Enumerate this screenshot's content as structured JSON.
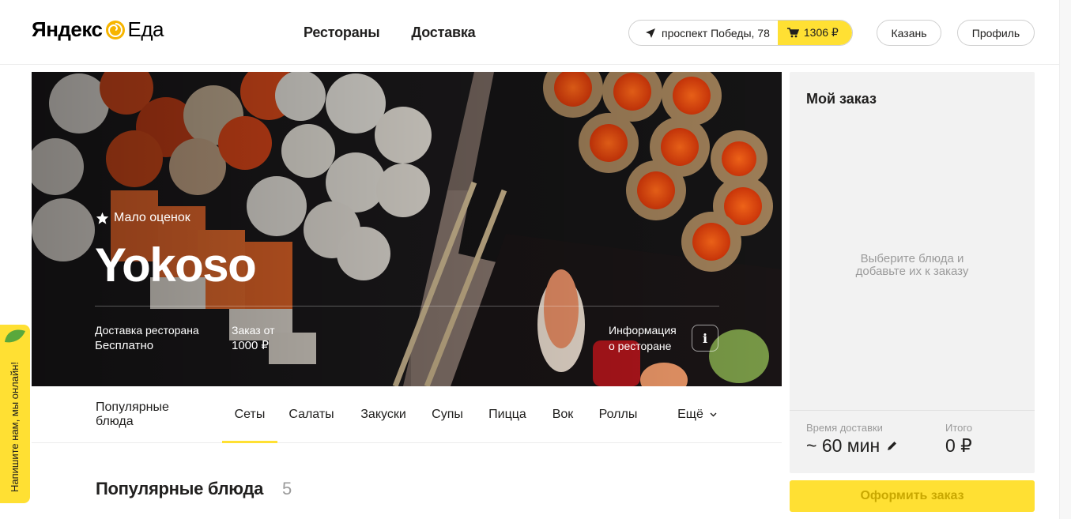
{
  "header": {
    "logo_brand": "Яндекс",
    "logo_product": "Еда",
    "nav": [
      "Рестораны",
      "Доставка"
    ],
    "address": "проспект Победы, 78",
    "cart_total": "1306 ₽",
    "city": "Казань",
    "profile": "Профиль",
    "accent_color": "#ffe033"
  },
  "hero": {
    "rating_label": "Мало оценок",
    "restaurant_name": "Yokoso",
    "delivery_label": "Доставка ресторана",
    "delivery_value": "Бесплатно",
    "min_order_label": "Заказ от",
    "min_order_value": "1000 ₽",
    "info_label_line1": "Информация",
    "info_label_line2": "о ресторане",
    "info_icon": "i"
  },
  "tabs": {
    "items": [
      "Популярные блюда",
      "Сеты",
      "Салаты",
      "Закуски",
      "Супы",
      "Пицца",
      "Вок",
      "Роллы"
    ],
    "more": "Ещё",
    "active_index": 1
  },
  "section": {
    "title": "Популярные блюда",
    "count": "5"
  },
  "order": {
    "title": "Мой заказ",
    "empty_line1": "Выберите блюда и",
    "empty_line2": "добавьте их к заказу",
    "delivery_time_label": "Время доставки",
    "delivery_time_value": "~ 60 мин",
    "total_label": "Итого",
    "total_value": "0 ₽",
    "checkout_label": "Оформить заказ"
  },
  "chat_widget": {
    "label": "Напишите нам, мы онлайн!"
  }
}
